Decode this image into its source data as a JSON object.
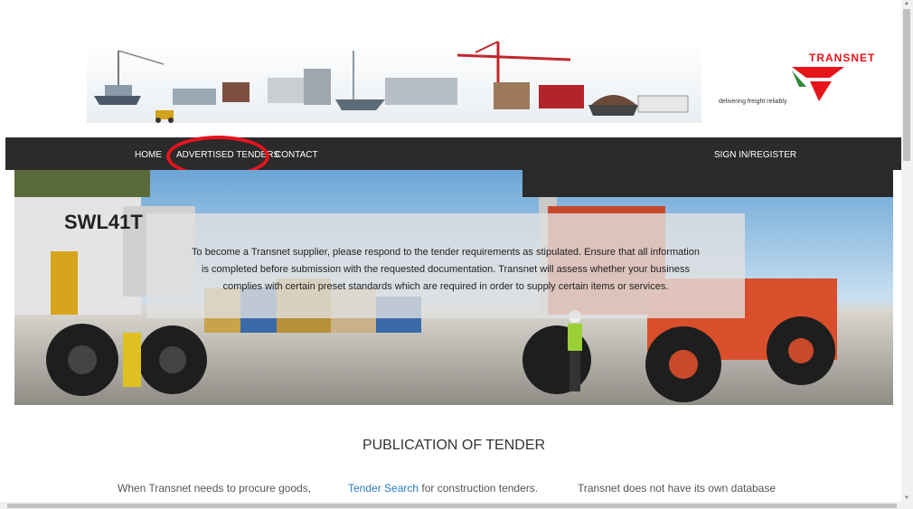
{
  "brand": {
    "name": "TRANSNET",
    "tagline": "delivering freight reliably",
    "accent_color": "#e8141c",
    "logo_icon": "transnet-logo-icon"
  },
  "nav": {
    "home": "HOME",
    "advertised_tenders": "ADVERTISED TENDERS",
    "contact": "CONTACT",
    "sign_in": "SIGN IN/REGISTER"
  },
  "hero": {
    "message_line1": "To become a Transnet supplier, please respond to the tender requirements as stipulated. Ensure that all information",
    "message_line2": "is completed before submission with the requested documentation. Transnet will assess whether your business",
    "message_line3": "complies with certain preset standards which are required in order to supply certain items or services.",
    "vehicle_label": "SWL41T"
  },
  "publication": {
    "title": "PUBLICATION OF TENDER",
    "col1_line1": "When Transnet needs to procure goods,",
    "col2_link": "Tender Search",
    "col2_text": " for construction tenders.",
    "col3_line1": "Transnet does not have its own database"
  }
}
